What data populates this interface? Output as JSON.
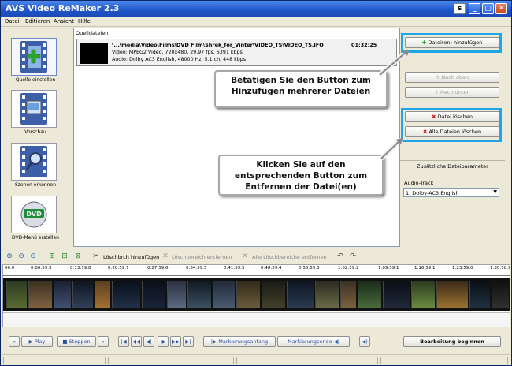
{
  "window": {
    "title": "AVS Video ReMaker 2.3",
    "controls": [
      "s",
      "_",
      "□",
      "✕"
    ]
  },
  "menu": [
    "Datei",
    "Editieren",
    "Ansicht",
    "Hilfe"
  ],
  "left_nav": [
    {
      "label": "Quelle einstellen",
      "icon": "add-source-film-icon"
    },
    {
      "label": "Vorschau",
      "icon": "preview-film-icon"
    },
    {
      "label": "Szenen erkennen",
      "icon": "scene-detect-film-icon"
    },
    {
      "label": "DVD-Menü erstellen",
      "icon": "dvd-disc-icon",
      "badge": "DVD"
    }
  ],
  "source": {
    "header": "Quelldateien",
    "file": {
      "path": "\\...\\media\\Video\\Films\\DVD Film\\Shrek_for_Vinter\\VIDEO_TS\\VIDEO_TS.IFO",
      "duration": "01:32:25",
      "video": "Video: MPEG2 Video, 720x480, 29,97 fps, 6391 kbps",
      "audio": "Audio: Dolby AC3 English, 48000 Hz, 5.1 ch, 448 kbps"
    }
  },
  "right": {
    "add_files": "Datei(en) hinzufügen",
    "move_up": "Nach oben",
    "move_down": "Nach unten",
    "delete_file": "Datei löschen",
    "delete_all": "Alle Dateien löschen",
    "params_title": "Zusätzliche Dateiparameter",
    "audio_track_label": "Audio-Track",
    "audio_track_value": "1. Dolby-AC3 English"
  },
  "callouts": {
    "add": "Betätigen Sie den Button zum Hinzufügen mehrerer Dateien",
    "remove": "Klicken Sie auf den entsprechenden Button zum Entfernen der Datei(en)"
  },
  "toolbar": {
    "add_cut": "Löschbrch hinzufügen",
    "remove_cut": "Löschbereich entfernen",
    "remove_all_cuts": "Alle Löschbereiche entfernen"
  },
  "ruler": [
    "00.0",
    "0:06:59.9",
    "0:13:59.8",
    "0:20:59.7",
    "0:27:59.6",
    "0:34:59.5",
    "0:41:59.5",
    "0:48:59.4",
    "0:55:59.3",
    "1:02:59.2",
    "1:09:59.1",
    "1:16:59.1",
    "1:23:59.0",
    "1:30:58.9"
  ],
  "playback": {
    "play": "Play",
    "stop": "Stoppen",
    "mark_start": "Markierungsanfang",
    "mark_end": "Markierungsende",
    "start_edit": "Bearbeitung beginnen"
  },
  "colors": {
    "highlight": "#1ea6e8",
    "titlebar": "#2056c8",
    "panel": "#ece9d8"
  }
}
